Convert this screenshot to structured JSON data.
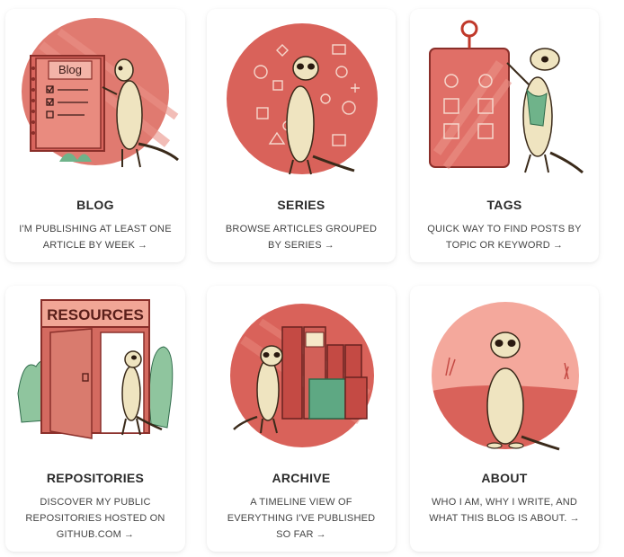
{
  "cards": [
    {
      "title": "BLOG",
      "description": "I'M PUBLISHING AT LEAST ONE ARTICLE BY WEEK",
      "arrow": "→",
      "sign": "Blog"
    },
    {
      "title": "SERIES",
      "description": "BROWSE ARTICLES GROUPED BY SERIES",
      "arrow": "→"
    },
    {
      "title": "TAGS",
      "description": "QUICK WAY TO FIND POSTS BY TOPIC OR KEYWORD",
      "arrow": "→"
    },
    {
      "title": "REPOSITORIES",
      "description": "DISCOVER MY PUBLIC REPOSITORIES HOSTED ON GITHUB.COM",
      "arrow": "→",
      "sign": "RESOURCES"
    },
    {
      "title": "ARCHIVE",
      "description": "A TIMELINE VIEW OF EVERYTHING I'VE PUBLISHED SO FAR",
      "arrow": "→"
    },
    {
      "title": "ABOUT",
      "description": "WHO I AM, WHY I WRITE, AND WHAT THIS BLOG IS ABOUT.",
      "arrow": "→"
    }
  ],
  "colors": {
    "accent": "#d9625a",
    "accent_light": "#f2a79c",
    "meerkat": "#efe4c0",
    "green": "#6fb38a"
  },
  "icons": [
    "meerkat-illustration",
    "arrow-right-icon"
  ]
}
